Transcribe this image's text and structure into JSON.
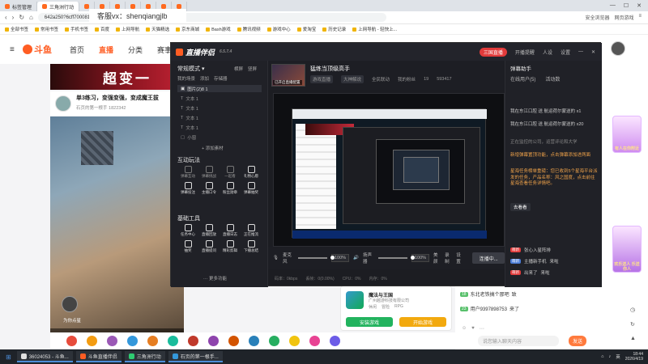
{
  "browser": {
    "tabs": [
      "标签管理",
      "三角洲行动",
      "",
      "",
      "",
      "",
      "",
      "",
      "",
      ""
    ],
    "url": "642a250?6cff700081701",
    "addr_right": [
      "安全浏览器",
      "网页游戏"
    ],
    "bookmarks": [
      "全部书签",
      "常用书签",
      "手机书签",
      "百度",
      "上网导航",
      "天猫精选",
      "京东商城",
      "Bash游戏",
      "腾讯视频",
      "游戏中心",
      "爱淘宝",
      "历史记录",
      "上网导航 - 轻快上..."
    ],
    "overlay_text": "客服vx：shenqiangjlb"
  },
  "site": {
    "logo": "斗鱼",
    "nav": [
      "首页",
      "直播",
      "分类",
      "赛事",
      "游戏"
    ],
    "banner": "超变一",
    "room_title": "单3练习，变强变强，变成魔王拔",
    "room_sub": "石页的第一根手",
    "room_num": "1822342",
    "player_name": "为你点星",
    "right_header": [
      "恐龙",
      "白万",
      "详情"
    ],
    "gift_caption_1": "有人在你附近",
    "gift_caption_2": "欢乐送人\n乐送你人",
    "chat": [
      {
        "level": "18",
        "user": "东北老铁搞个那吧",
        "msg": "致"
      },
      {
        "level": "23",
        "user": "用户9397898753",
        "msg": "来了"
      }
    ],
    "chat_input_placeholder": "说您输入聊天内容",
    "send_label": "发送",
    "ad": {
      "title": "魔法与王国",
      "sub": "广州越游科技有限公司",
      "tags": [
        "休闲",
        "冒险",
        "RPG"
      ],
      "btn_download": "安装游戏",
      "btn_play": "开始游戏"
    }
  },
  "app": {
    "title": "直播伴侣",
    "version": "6.5.7.4",
    "top_right": [
      "三国直播",
      "开播提醒",
      "人设",
      "设置"
    ],
    "left": {
      "mode": "常规模式",
      "mode_tabs": [
        "横屏",
        "竖屏"
      ],
      "scene_tabs": [
        "我的场景",
        "添加",
        "存储器"
      ],
      "scenes": [
        "图片(2)8 1",
        "文本 1",
        "文本 1",
        "文本 1",
        "文本 1",
        "小窗"
      ],
      "add_material": "添加素材",
      "interact_title": "互动玩法",
      "interact_items": [
        "弹幕互动",
        "弹幕挑战",
        "一起看",
        "礼物心愿",
        "弹幕投注",
        "主播口令",
        "粉丝勋章",
        "弹幕抽奖"
      ],
      "tools_title": "基础工具",
      "tools_items": [
        "任务中心",
        "直播回放",
        "直播日志",
        "正在推流",
        "抽奖",
        "直播提问",
        "精彩剪辑",
        "下播总结"
      ],
      "more": "更多功能"
    },
    "head": {
      "title": "猛练当顶级高手",
      "meta": [
        "游戏直播",
        "大神解说"
      ],
      "stats": [
        "全民联动",
        "我的粉丝",
        "19",
        "593417"
      ],
      "thumb_caption": "已开启直播配置"
    },
    "controls": {
      "mic_label": "麦克风",
      "mic_pct": "100%",
      "speaker_label": "扬声器",
      "speaker_pct": "100%",
      "btns": [
        "美颜",
        "录制",
        "设置"
      ],
      "start": "连播中..."
    },
    "status": [
      "码率：0kbps",
      "丢帧：0(0.00%)",
      "CPU：0%",
      "内存：0%"
    ],
    "right": {
      "title": "弹幕助手",
      "tabs": [
        "在线用户(5)",
        "活动数"
      ],
      "lines": [
        "我在东江口腔 送 航运荷尔蒙送的 x1",
        "我在东江口腔 送 航运荷尔蒙送的 x20",
        "正在监控的公司，运营评论和大学",
        "新增弹幕置顶功能，点击弹幕添加进两面",
        "星海任务榜单重磅：您已收到5个星海平台派发的任务，产品名称：风之国度，点击前往星海查看任务详情吧。"
      ],
      "view_btn": "去看看",
      "bottom": [
        {
          "badge": "萌新",
          "name": "张心入星阵排",
          "text": ""
        },
        {
          "badge": "萌新",
          "name": "主播新手机",
          "text": "来啦"
        },
        {
          "badge": "萌新",
          "name": "出来了",
          "text": "来啦"
        }
      ]
    }
  },
  "taskbar": {
    "items": [
      "36024053 - 斗鱼...",
      "斗鱼直播伴侣",
      "三角洲行动",
      "石页的第一根手..."
    ],
    "time": "18:44",
    "date": "2026/4/19",
    "lang": "英"
  },
  "colors": {
    "brand": "#ff5d23",
    "app_bg": "#1c1d22",
    "accent_red": "#e23b3b"
  }
}
